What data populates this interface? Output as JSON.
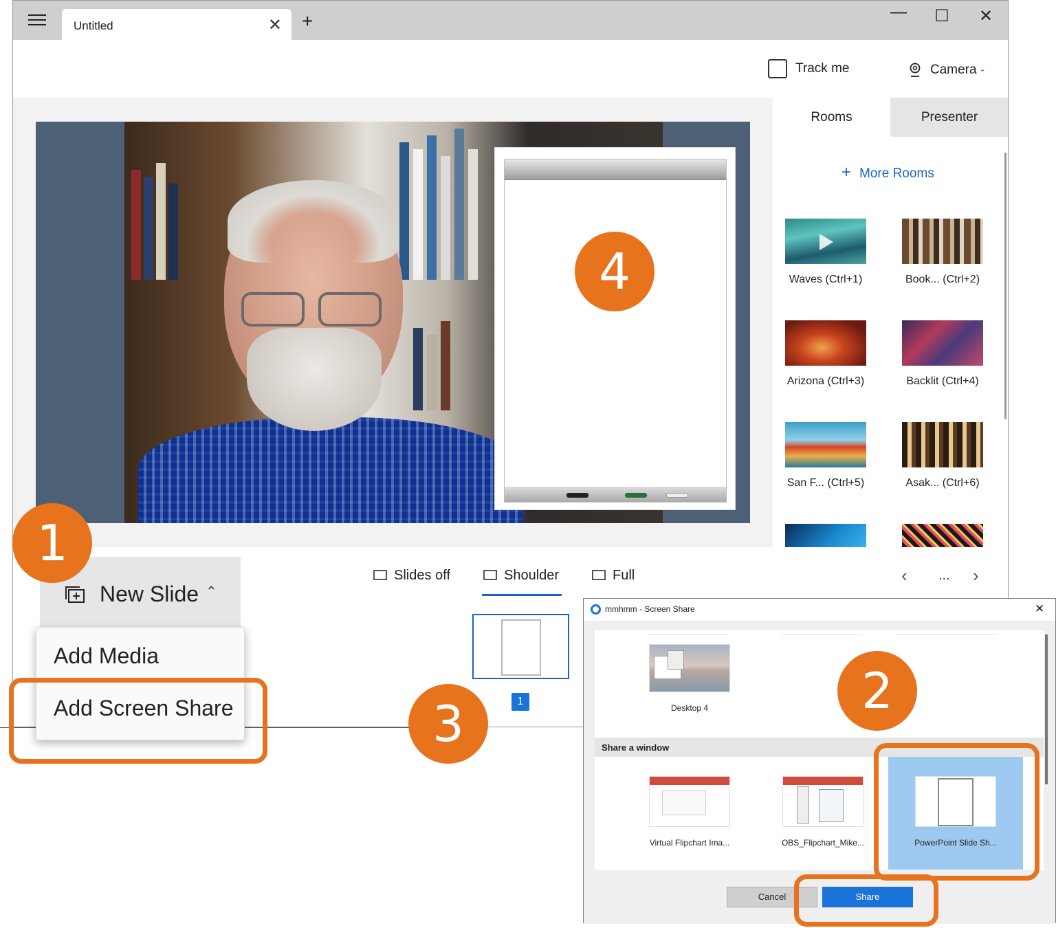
{
  "window": {
    "tab_title": "Untitled",
    "tab_close": "✕",
    "new_tab": "+",
    "min": "—",
    "max": "☐",
    "close": "✕"
  },
  "topbar": {
    "track_label": "Track me",
    "track_checked": false,
    "camera_label": "Camera"
  },
  "sidebar": {
    "tabs": [
      "Rooms",
      "Presenter"
    ],
    "active_tab": "Rooms",
    "more_rooms": "More Rooms",
    "rooms": [
      {
        "label": "Waves (Ctrl+1)",
        "icon": "waves-thumb"
      },
      {
        "label": "Book... (Ctrl+2)",
        "icon": "bookshelf-thumb"
      },
      {
        "label": "Arizona (Ctrl+3)",
        "icon": "arizona-thumb"
      },
      {
        "label": "Backlit (Ctrl+4)",
        "icon": "backlit-thumb"
      },
      {
        "label": "San F... (Ctrl+5)",
        "icon": "san-francisco-thumb"
      },
      {
        "label": "Asak... (Ctrl+6)",
        "icon": "asakusa-thumb"
      }
    ]
  },
  "bottombar": {
    "views": [
      "Slides off",
      "Shoulder",
      "Full"
    ],
    "active_view": "Shoulder",
    "nav_more": "...",
    "slide_number": "1"
  },
  "new_slide": {
    "label": "New Slide",
    "menu": [
      "Add Media",
      "Add Screen Share"
    ]
  },
  "callouts": [
    "1",
    "2",
    "3",
    "4"
  ],
  "dialog": {
    "title": "mmhmm - Screen Share",
    "close": "✕",
    "desktop_item": "Desktop 4",
    "section_header": "Share a window",
    "windows": [
      "Virtual Flipchart Ima...",
      "OBS_Flipchart_Mike...",
      "PowerPoint Slide Sh..."
    ],
    "selected_window": "PowerPoint Slide Sh...",
    "cancel": "Cancel",
    "share": "Share"
  },
  "colors": {
    "accent": "#1a63c9",
    "callout": "#e8731d",
    "stage_bg": "#4d6076",
    "selected": "#9dc8f0"
  }
}
